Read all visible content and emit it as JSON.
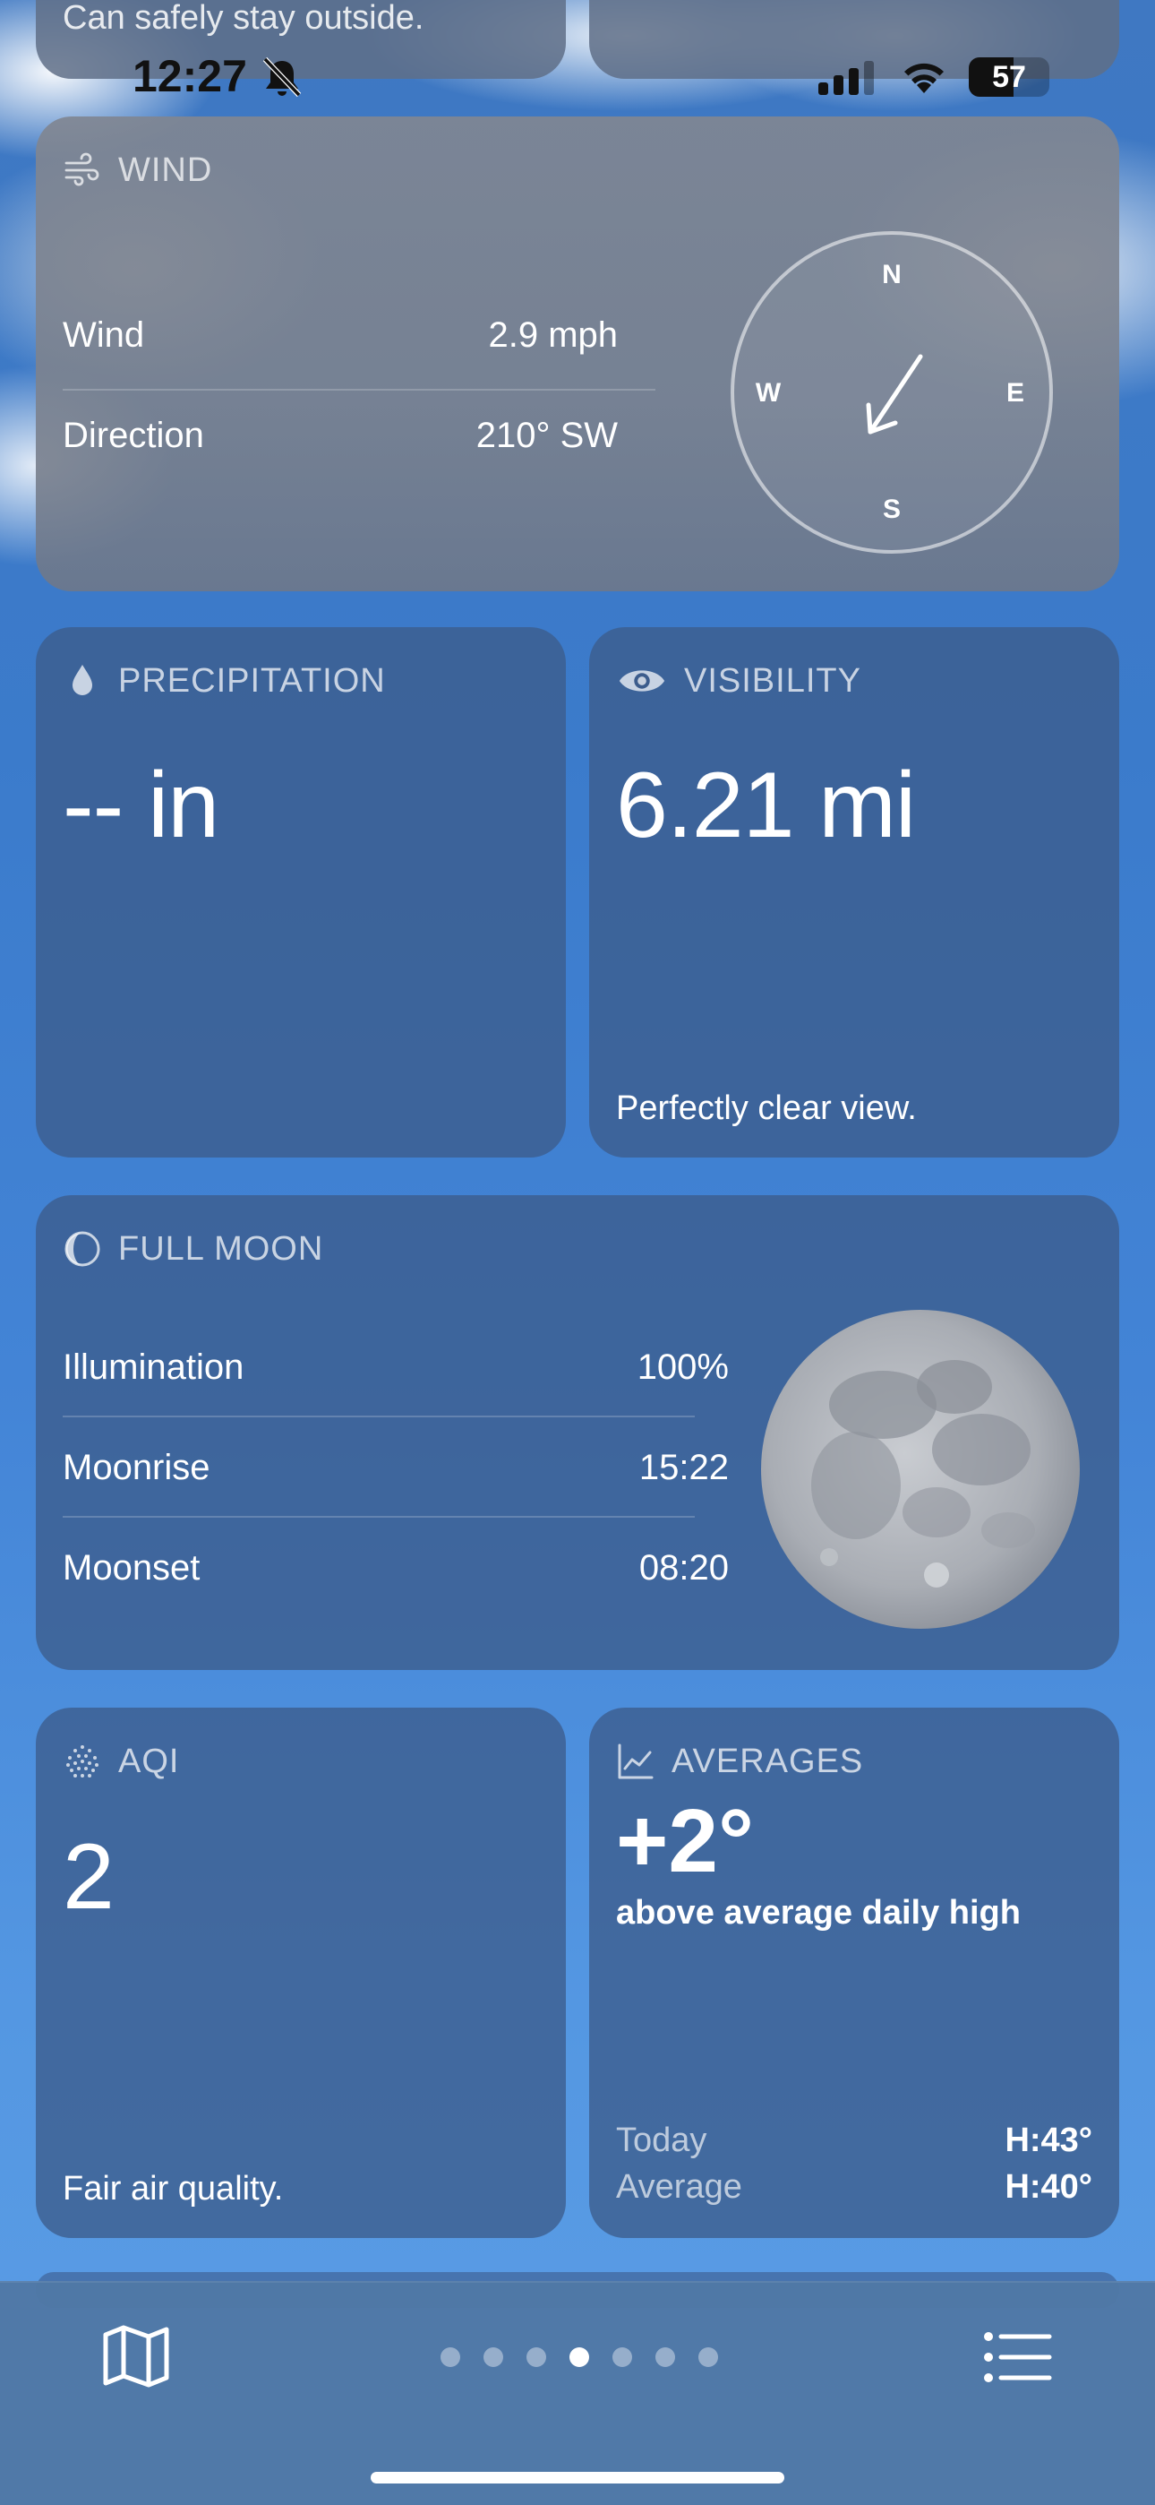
{
  "status_bar": {
    "time": "12:27",
    "battery": "57",
    "top_text": "Can safely stay outside."
  },
  "wind": {
    "header": "WIND",
    "rows": [
      {
        "label": "Wind",
        "value": "2.9 mph"
      },
      {
        "label": "Direction",
        "value": "210° SW"
      }
    ],
    "compass": {
      "n": "N",
      "e": "E",
      "s": "S",
      "w": "W",
      "direction_degrees": 210
    }
  },
  "precipitation": {
    "header": "PRECIPITATION",
    "value": "-- in"
  },
  "visibility": {
    "header": "VISIBILITY",
    "value": "6.21 mi",
    "description": "Perfectly clear view."
  },
  "moon": {
    "header": "FULL MOON",
    "rows": [
      {
        "label": "Illumination",
        "value": "100%"
      },
      {
        "label": "Moonrise",
        "value": "15:22"
      },
      {
        "label": "Moonset",
        "value": "08:20"
      }
    ]
  },
  "aqi": {
    "header": "AQI",
    "value": "2",
    "description": "Fair air quality."
  },
  "averages": {
    "header": "AVERAGES",
    "value": "+2°",
    "description": "above average daily high",
    "today_label": "Today",
    "today_value": "H:43°",
    "average_label": "Average",
    "average_value": "H:40°"
  },
  "bottom_bar": {
    "page_count": 7,
    "active_page": 4
  },
  "colors": {
    "sky": "#3f78c2",
    "card": "#3c5c8c",
    "wind_card": "#80869a"
  }
}
